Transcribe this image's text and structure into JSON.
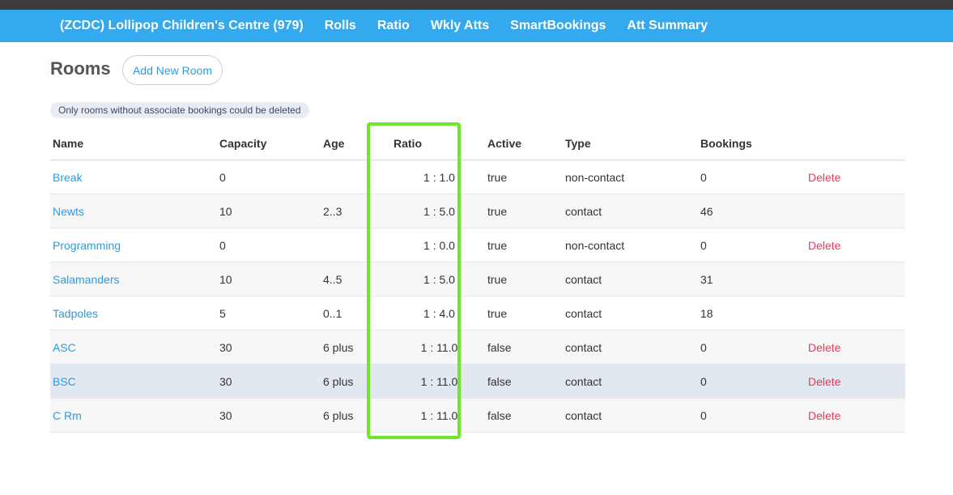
{
  "nav": {
    "brand": "(ZCDC) Lollipop Children's Centre (979)",
    "items": [
      "Rolls",
      "Ratio",
      "Wkly Atts",
      "SmartBookings",
      "Att Summary"
    ]
  },
  "page": {
    "title": "Rooms",
    "add_button": "Add New Room",
    "notice": "Only rooms without associate bookings could be deleted"
  },
  "table": {
    "headers": [
      "Name",
      "Capacity",
      "Age",
      "Ratio",
      "Active",
      "Type",
      "Bookings",
      ""
    ],
    "rows": [
      {
        "name": "Break",
        "capacity": "0",
        "age": "",
        "ratio": "1 : 1.0",
        "active": "true",
        "type": "non-contact",
        "bookings": "0",
        "action": "Delete"
      },
      {
        "name": "Newts",
        "capacity": "10",
        "age": "2..3",
        "ratio": "1 : 5.0",
        "active": "true",
        "type": "contact",
        "bookings": "46",
        "action": ""
      },
      {
        "name": "Programming",
        "capacity": "0",
        "age": "",
        "ratio": "1 : 0.0",
        "active": "true",
        "type": "non-contact",
        "bookings": "0",
        "action": "Delete"
      },
      {
        "name": "Salamanders",
        "capacity": "10",
        "age": "4..5",
        "ratio": "1 : 5.0",
        "active": "true",
        "type": "contact",
        "bookings": "31",
        "action": ""
      },
      {
        "name": "Tadpoles",
        "capacity": "5",
        "age": "0..1",
        "ratio": "1 : 4.0",
        "active": "true",
        "type": "contact",
        "bookings": "18",
        "action": ""
      },
      {
        "name": "ASC",
        "capacity": "30",
        "age": "6 plus",
        "ratio": "1 : 11.0",
        "active": "false",
        "type": "contact",
        "bookings": "0",
        "action": "Delete"
      },
      {
        "name": "BSC",
        "capacity": "30",
        "age": "6 plus",
        "ratio": "1 : 11.0",
        "active": "false",
        "type": "contact",
        "bookings": "0",
        "action": "Delete"
      },
      {
        "name": "C Rm",
        "capacity": "30",
        "age": "6 plus",
        "ratio": "1 : 11.0",
        "active": "false",
        "type": "contact",
        "bookings": "0",
        "action": "Delete"
      }
    ]
  },
  "colors": {
    "navbar": "#35a9ee",
    "link": "#2d9be0",
    "delete": "#e8375a",
    "highlight_box": "#6ee62a",
    "hovered_row": "#e1e8f0"
  }
}
